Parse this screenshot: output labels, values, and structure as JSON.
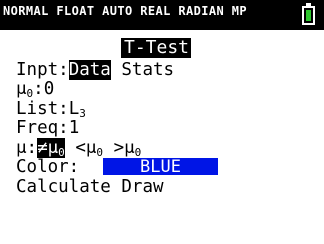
{
  "status_bar": {
    "text": "NORMAL FLOAT AUTO REAL RADIAN MP",
    "battery_icon": "battery-full-icon"
  },
  "title": "T-Test",
  "inpt": {
    "label": "Inpt:",
    "options": [
      "Data",
      "Stats"
    ],
    "selected": "Data"
  },
  "mu0": {
    "label": "μ",
    "sub": "0",
    "suffix": ":",
    "value": "0"
  },
  "list": {
    "label": "List:",
    "value": "L",
    "value_sub": "3"
  },
  "freq": {
    "label": "Freq:",
    "value": "1"
  },
  "alt_hypothesis": {
    "label": "μ:",
    "options": [
      {
        "symbol": "≠μ",
        "sub": "0"
      },
      {
        "symbol": "<μ",
        "sub": "0"
      },
      {
        "symbol": ">μ",
        "sub": "0"
      }
    ],
    "selected_index": 0
  },
  "color": {
    "label": "Color:",
    "value": "BLUE",
    "swatch": "#0015e6"
  },
  "actions": {
    "calculate": "Calculate",
    "draw": "Draw"
  },
  "colors": {
    "status_bg": "#000000",
    "status_text": "#ffffff",
    "battery": "#2ec72e",
    "highlight_bg": "#000000",
    "highlight_text": "#ffffff"
  }
}
